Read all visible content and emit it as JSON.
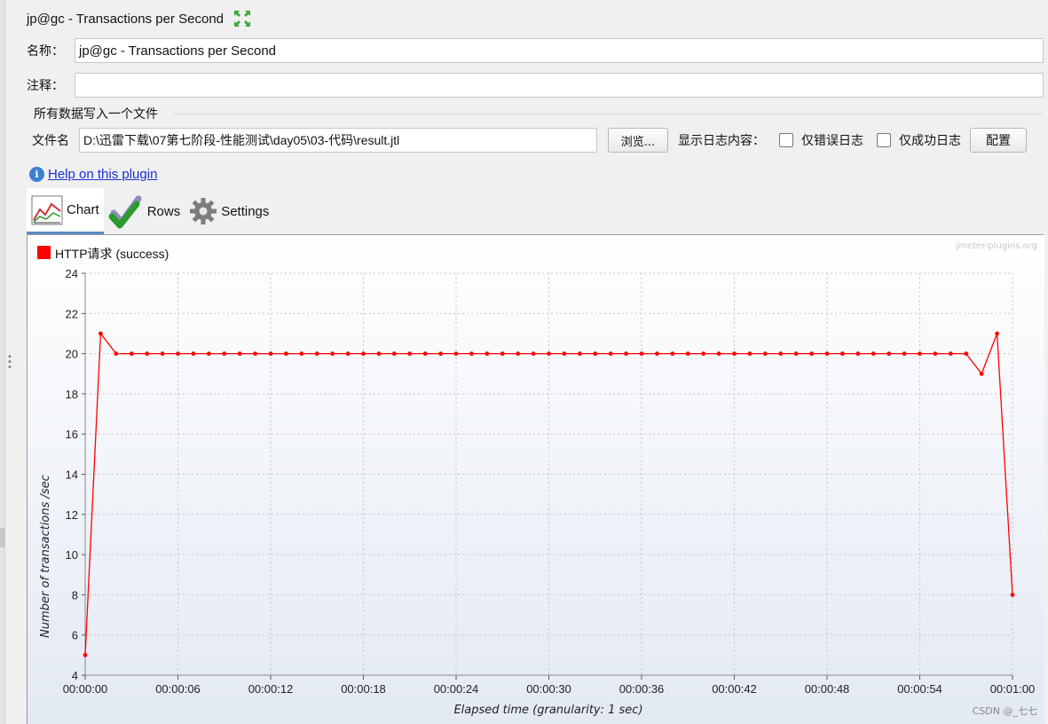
{
  "window": {
    "title": "jp@gc - Transactions per Second"
  },
  "form": {
    "name_label": "名称：",
    "name_value": "jp@gc - Transactions per Second",
    "comment_label": "注释：",
    "comment_value": ""
  },
  "file_group": {
    "title": "所有数据写入一个文件",
    "file_label": "文件名",
    "file_value": "D:\\迅雷下载\\07第七阶段-性能测试\\day05\\03-代码\\result.jtl",
    "browse_label": "浏览...",
    "log_label": "显示日志内容：",
    "errors_only_label": "仅错误日志",
    "errors_only_checked": false,
    "success_only_label": "仅成功日志",
    "success_only_checked": false,
    "config_label": "配置"
  },
  "help": {
    "link_label": "Help on this plugin"
  },
  "tabs": [
    {
      "label": "Chart",
      "icon": "chart-icon",
      "active": true
    },
    {
      "label": "Rows",
      "icon": "rows-checkmark-icon",
      "active": false
    },
    {
      "label": "Settings",
      "icon": "gear-icon",
      "active": false
    }
  ],
  "watermark": "jmeter-plugins.org",
  "csdn_mark": "CSDN @_七七",
  "chart_data": {
    "type": "line",
    "legend": [
      {
        "name": "HTTP请求 (success)",
        "color": "#ff0000"
      }
    ],
    "legend_position": "top-left",
    "xlabel": "Elapsed time (granularity: 1 sec)",
    "ylabel": "Number of transactions /sec",
    "xlim": [
      0,
      60
    ],
    "ylim": [
      4,
      24
    ],
    "grid": true,
    "x_ticks": [
      "00:00:00",
      "00:00:06",
      "00:00:12",
      "00:00:18",
      "00:00:24",
      "00:00:30",
      "00:00:36",
      "00:00:42",
      "00:00:48",
      "00:00:54",
      "00:01:00"
    ],
    "y_ticks": [
      4,
      6,
      8,
      10,
      12,
      14,
      16,
      18,
      20,
      22,
      24
    ],
    "series": [
      {
        "name": "HTTP请求 (success)",
        "color": "#ff0000",
        "x": [
          0,
          1,
          2,
          3,
          4,
          5,
          6,
          7,
          8,
          9,
          10,
          11,
          12,
          13,
          14,
          15,
          16,
          17,
          18,
          19,
          20,
          21,
          22,
          23,
          24,
          25,
          26,
          27,
          28,
          29,
          30,
          31,
          32,
          33,
          34,
          35,
          36,
          37,
          38,
          39,
          40,
          41,
          42,
          43,
          44,
          45,
          46,
          47,
          48,
          49,
          50,
          51,
          52,
          53,
          54,
          55,
          56,
          57,
          58,
          59,
          60
        ],
        "values": [
          5,
          21,
          20,
          20,
          20,
          20,
          20,
          20,
          20,
          20,
          20,
          20,
          20,
          20,
          20,
          20,
          20,
          20,
          20,
          20,
          20,
          20,
          20,
          20,
          20,
          20,
          20,
          20,
          20,
          20,
          20,
          20,
          20,
          20,
          20,
          20,
          20,
          20,
          20,
          20,
          20,
          20,
          20,
          20,
          20,
          20,
          20,
          20,
          20,
          20,
          20,
          20,
          20,
          20,
          20,
          20,
          20,
          20,
          19,
          21,
          8
        ]
      }
    ]
  }
}
